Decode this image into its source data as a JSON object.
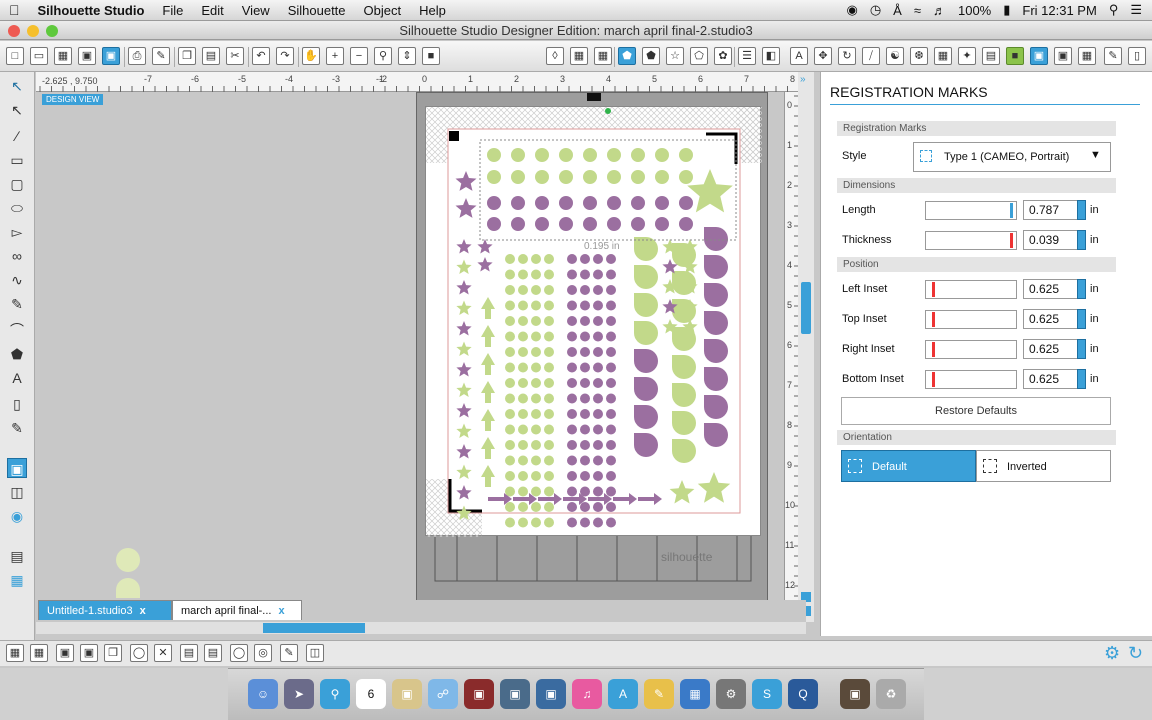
{
  "menubar": {
    "items": [
      "Silhouette Studio",
      "File",
      "Edit",
      "View",
      "Silhouette",
      "Object",
      "Help"
    ],
    "battery": "100%",
    "clock": "Fri 12:31 PM"
  },
  "window": {
    "title": "Silhouette Studio Designer Edition: march april final-2.studio3"
  },
  "canvas": {
    "coordinates": "-2.625 , 9.750",
    "design_view": "DESIGN VIEW",
    "ruler_top": [
      "-7",
      "-6",
      "-5",
      "-4",
      "-3",
      "-2",
      "-1",
      "0",
      "1",
      "2",
      "3",
      "4",
      "5",
      "6",
      "7",
      "8"
    ],
    "ruler_right": [
      "0",
      "1",
      "2",
      "3",
      "4",
      "5",
      "6",
      "7",
      "8",
      "9",
      "10",
      "11",
      "12"
    ],
    "size_label": "0.195 in",
    "mat_brand": "silhouette"
  },
  "tabs": [
    {
      "label": "Untitled-1.studio3",
      "close": "x"
    },
    {
      "label": "march april final-...",
      "close": "x"
    }
  ],
  "panel": {
    "title": "REGISTRATION MARKS",
    "sec_reg": "Registration Marks",
    "style_label": "Style",
    "style_value": "Type 1 (CAMEO, Portrait)",
    "sec_dim": "Dimensions",
    "length_label": "Length",
    "length_value": "0.787",
    "thickness_label": "Thickness",
    "thickness_value": "0.039",
    "sec_pos": "Position",
    "left_label": "Left Inset",
    "left_value": "0.625",
    "top_label": "Top Inset",
    "top_value": "0.625",
    "right_label": "Right Inset",
    "right_value": "0.625",
    "bottom_label": "Bottom Inset",
    "bottom_value": "0.625",
    "unit": "in",
    "restore": "Restore Defaults",
    "sec_orient": "Orientation",
    "default": "Default",
    "inverted": "Inverted"
  },
  "dock": {
    "calendar_day": "6"
  },
  "colors": {
    "accent": "#3aa0d8",
    "purple": "#9b6fa0",
    "green": "#c2d98a"
  }
}
